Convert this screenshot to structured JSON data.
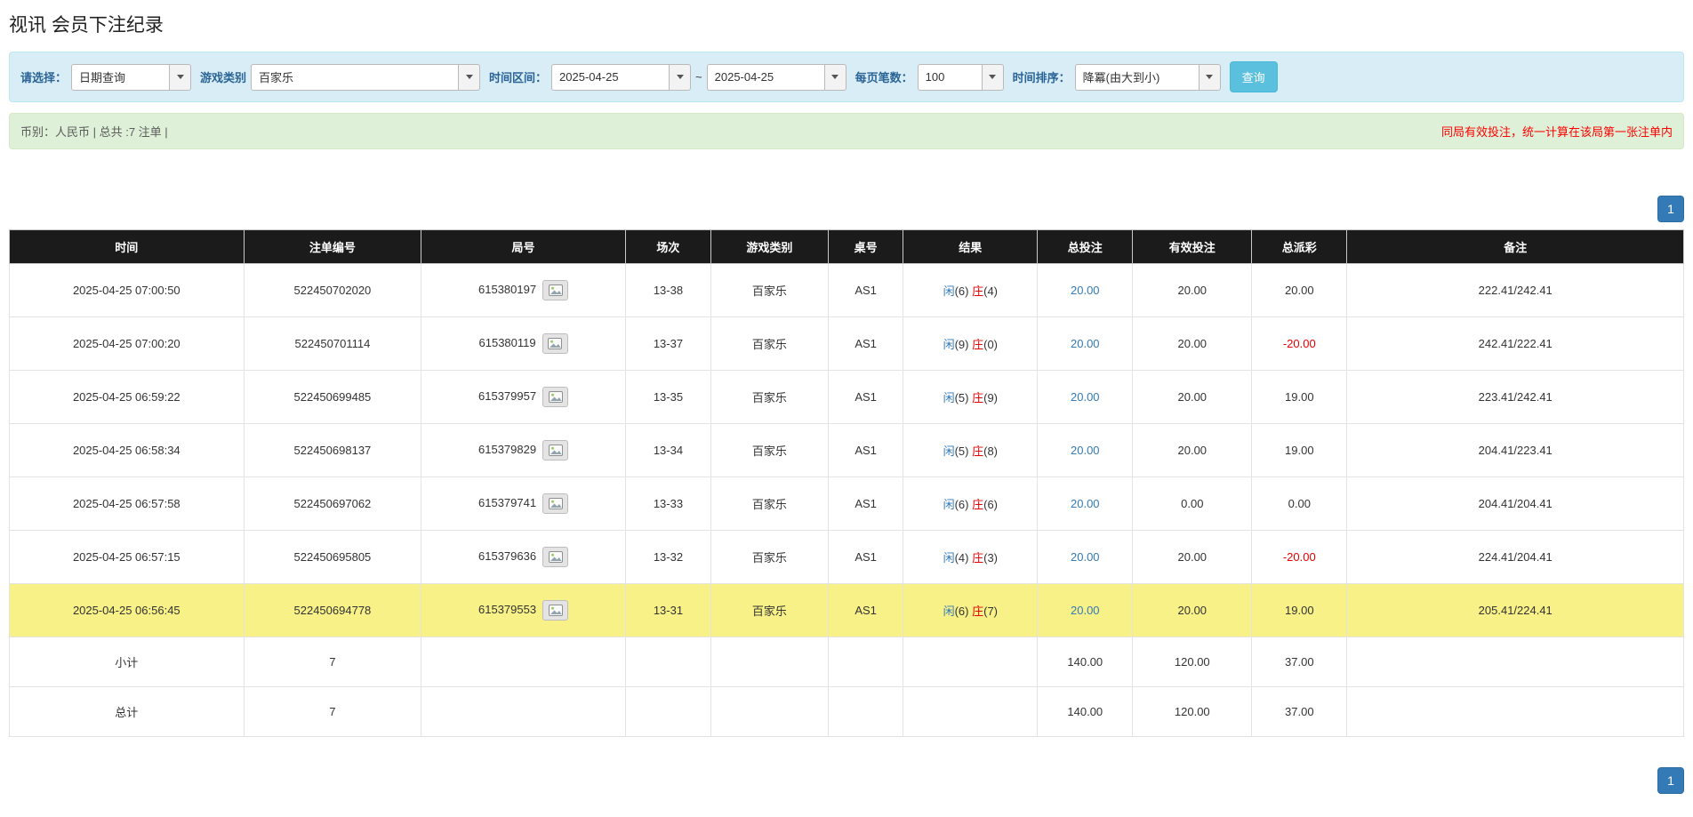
{
  "page": {
    "title": "视讯 会员下注纪录"
  },
  "filters": {
    "query_type_label": "请选择：",
    "query_type_value": "日期查询",
    "game_type_label": "游戏类别",
    "game_type_value": "百家乐",
    "time_range_label": "时间区间：",
    "date_from": "2025-04-25",
    "range_separator": "~",
    "date_to": "2025-04-25",
    "page_size_label": "每页笔数：",
    "page_size_value": "100",
    "sort_label": "时间排序：",
    "sort_value": "降冪(由大到小)",
    "search_button_label": "查询"
  },
  "info_bar": {
    "summary_text": "币别：人民币 | 总共 :7 注单 |",
    "notice_text": "同局有效投注，统一计算在该局第一张注单内"
  },
  "pagination": {
    "current_page": "1"
  },
  "table": {
    "headers": [
      "时间",
      "注单编号",
      "局号",
      "场次",
      "游戏类别",
      "桌号",
      "结果",
      "总投注",
      "有效投注",
      "总派彩",
      "备注"
    ],
    "rows": [
      {
        "time": "2025-04-25 07:00:50",
        "bet_id": "522450702020",
        "round_id": "615380197",
        "session": "13-38",
        "game": "百家乐",
        "table_no": "AS1",
        "player": "闲",
        "player_score": "(6)",
        "banker": "庄",
        "banker_score": "(4)",
        "total_bet": "20.00",
        "valid_bet": "20.00",
        "payout": "20.00",
        "remark": "222.41/242.41",
        "highlight": false
      },
      {
        "time": "2025-04-25 07:00:20",
        "bet_id": "522450701114",
        "round_id": "615380119",
        "session": "13-37",
        "game": "百家乐",
        "table_no": "AS1",
        "player": "闲",
        "player_score": "(9)",
        "banker": "庄",
        "banker_score": "(0)",
        "total_bet": "20.00",
        "valid_bet": "20.00",
        "payout": "-20.00",
        "remark": "242.41/222.41",
        "highlight": false
      },
      {
        "time": "2025-04-25 06:59:22",
        "bet_id": "522450699485",
        "round_id": "615379957",
        "session": "13-35",
        "game": "百家乐",
        "table_no": "AS1",
        "player": "闲",
        "player_score": "(5)",
        "banker": "庄",
        "banker_score": "(9)",
        "total_bet": "20.00",
        "valid_bet": "20.00",
        "payout": "19.00",
        "remark": "223.41/242.41",
        "highlight": false
      },
      {
        "time": "2025-04-25 06:58:34",
        "bet_id": "522450698137",
        "round_id": "615379829",
        "session": "13-34",
        "game": "百家乐",
        "table_no": "AS1",
        "player": "闲",
        "player_score": "(5)",
        "banker": "庄",
        "banker_score": "(8)",
        "total_bet": "20.00",
        "valid_bet": "20.00",
        "payout": "19.00",
        "remark": "204.41/223.41",
        "highlight": false
      },
      {
        "time": "2025-04-25 06:57:58",
        "bet_id": "522450697062",
        "round_id": "615379741",
        "session": "13-33",
        "game": "百家乐",
        "table_no": "AS1",
        "player": "闲",
        "player_score": "(6)",
        "banker": "庄",
        "banker_score": "(6)",
        "total_bet": "20.00",
        "valid_bet": "0.00",
        "payout": "0.00",
        "remark": "204.41/204.41",
        "highlight": false
      },
      {
        "time": "2025-04-25 06:57:15",
        "bet_id": "522450695805",
        "round_id": "615379636",
        "session": "13-32",
        "game": "百家乐",
        "table_no": "AS1",
        "player": "闲",
        "player_score": "(4)",
        "banker": "庄",
        "banker_score": "(3)",
        "total_bet": "20.00",
        "valid_bet": "20.00",
        "payout": "-20.00",
        "remark": "224.41/204.41",
        "highlight": false
      },
      {
        "time": "2025-04-25 06:56:45",
        "bet_id": "522450694778",
        "round_id": "615379553",
        "session": "13-31",
        "game": "百家乐",
        "table_no": "AS1",
        "player": "闲",
        "player_score": "(6)",
        "banker": "庄",
        "banker_score": "(7)",
        "total_bet": "20.00",
        "valid_bet": "20.00",
        "payout": "19.00",
        "remark": "205.41/224.41",
        "highlight": true
      }
    ],
    "subtotal": {
      "label": "小计",
      "count": "7",
      "total_bet": "140.00",
      "valid_bet": "120.00",
      "payout": "37.00"
    },
    "grand_total": {
      "label": "总计",
      "count": "7",
      "total_bet": "140.00",
      "valid_bet": "120.00",
      "payout": "37.00"
    }
  },
  "colors": {
    "accent_blue": "#337ab7",
    "negative_red": "#e60000",
    "highlight_yellow": "#f7f188",
    "header_black": "#1b1b1b",
    "summary_gray": "#a6a6a6",
    "filter_bar_bg": "#d9edf7",
    "info_bar_bg": "#dff0d8",
    "search_button_bg": "#5bc0de"
  }
}
